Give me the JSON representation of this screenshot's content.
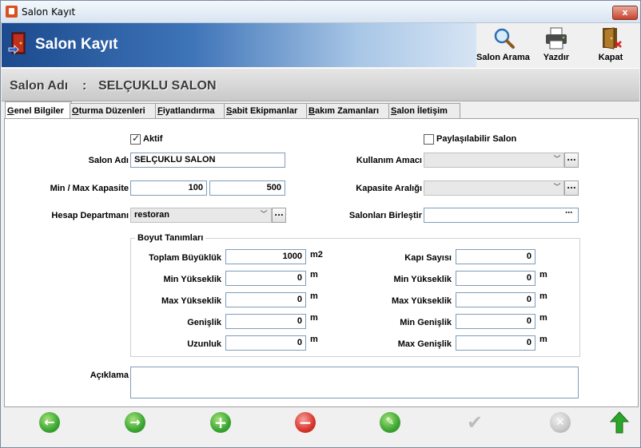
{
  "window": {
    "title": "Salon Kayıt",
    "close_label": "x"
  },
  "banner": {
    "title": "Salon Kayıt"
  },
  "toolbar": {
    "search_label": "Salon Arama",
    "print_label": "Yazdır",
    "close_label": "Kapat"
  },
  "header": {
    "salon_label": "Salon Adı",
    "separator": ":",
    "salon_name": "SELÇUKLU SALON"
  },
  "tabs": [
    {
      "underline": "G",
      "rest": "enel Bilgiler",
      "active": true
    },
    {
      "underline": "O",
      "rest": "turma Düzenleri",
      "active": false
    },
    {
      "underline": "F",
      "rest": "iyatlandırma",
      "active": false
    },
    {
      "underline": "S",
      "rest": "abit Ekipmanlar",
      "active": false
    },
    {
      "underline": "B",
      "rest": "akım Zamanları",
      "active": false
    },
    {
      "underline": "S",
      "rest": "alon İletişim",
      "active": false
    }
  ],
  "form": {
    "aktif_label": "Aktif",
    "aktif_checked": true,
    "paylasilabilir_label": "Paylaşılabilir Salon",
    "paylasilabilir_checked": false,
    "salon_adi_label": "Salon Adı",
    "salon_adi_value": "SELÇUKLU SALON",
    "kapasite_label": "Min / Max Kapasite",
    "min_kapasite": "100",
    "max_kapasite": "500",
    "departman_label": "Hesap Departmanı",
    "departman_value": "restoran",
    "kullanim_label": "Kullanım Amacı",
    "kullanim_value": "",
    "kapasite_araligi_label": "Kapasite Aralığı",
    "kapasite_araligi_value": "",
    "birlestir_label": "Salonları Birleştir",
    "birlestir_value": "",
    "aciklama_label": "Açıklama",
    "aciklama_value": ""
  },
  "boyut": {
    "title": "Boyut Tanımları",
    "left": [
      {
        "label": "Toplam Büyüklük",
        "value": "1000",
        "unit": "m2"
      },
      {
        "label": "Min Yükseklik",
        "value": "0",
        "unit": "m"
      },
      {
        "label": "Max Yükseklik",
        "value": "0",
        "unit": "m"
      },
      {
        "label": "Genişlik",
        "value": "0",
        "unit": "m"
      },
      {
        "label": "Uzunluk",
        "value": "0",
        "unit": "m"
      }
    ],
    "right": [
      {
        "label": "Kapı Sayısı",
        "value": "0",
        "unit": ""
      },
      {
        "label": "Min Yükseklik",
        "value": "0",
        "unit": "m"
      },
      {
        "label": "Max Yükseklik",
        "value": "0",
        "unit": "m"
      },
      {
        "label": "Min Genişlik",
        "value": "0",
        "unit": "m"
      },
      {
        "label": "Max Genişlik",
        "value": "0",
        "unit": "m"
      }
    ]
  },
  "dots_label": "...",
  "nav": {
    "prev_icon": "arrow-left-icon",
    "next_icon": "arrow-right-icon",
    "add_icon": "plus-icon",
    "delete_icon": "minus-icon",
    "edit_icon": "edit-icon",
    "save_icon": "check-icon",
    "cancel_icon": "x-icon",
    "exit_icon": "arrow-up-icon"
  },
  "colors": {
    "nav_green": "#3aa632",
    "nav_red": "#d9342b",
    "nav_disabled": "#bdbdbd",
    "banner_blue": "#1c4a8e"
  }
}
